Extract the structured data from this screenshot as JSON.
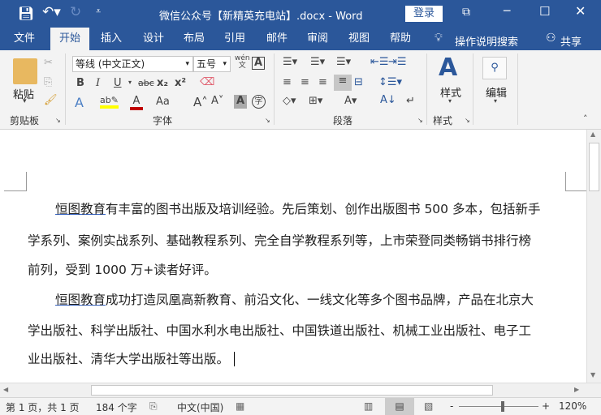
{
  "titlebar": {
    "doc_title": "微信公众号【新精英充电站】.docx - Word",
    "login": "登录",
    "save_icon": "save-icon",
    "undo_icon": "undo-icon",
    "redo_icon": "redo-icon"
  },
  "tabs": [
    "文件",
    "开始",
    "插入",
    "设计",
    "布局",
    "引用",
    "邮件",
    "审阅",
    "视图",
    "帮助"
  ],
  "tell_me": "操作说明搜索",
  "share": "共享",
  "ribbon": {
    "clipboard": {
      "paste": "粘贴",
      "label": "剪贴板"
    },
    "font": {
      "name": "等线 (中文正文)",
      "size": "五号",
      "label": "字体",
      "bold": "B",
      "italic": "I",
      "underline": "U",
      "strike": "abc",
      "sub": "x₂",
      "sup": "x²",
      "case": "Aa",
      "phonetic": "wén",
      "enclose": "字"
    },
    "paragraph": {
      "label": "段落"
    },
    "styles": {
      "button": "样式",
      "label": "样式"
    },
    "editing": {
      "button": "编辑"
    }
  },
  "document": {
    "lines": [
      {
        "link": "恒图教育",
        "text": "有丰富的图书出版及培训经验。先后策划、创作出版图书 500 多本，包括新手"
      },
      {
        "text": "学系列、案例实战系列、基础教程系列、完全自学教程系列等，上市荣登同类畅销书排行榜"
      },
      {
        "text": "前列，受到 1000 万+读者好评。"
      },
      {
        "link": "恒图教育",
        "text": "成功打造凤凰高新教育、前沿文化、一线文化等多个图书品牌，产品在北京大"
      },
      {
        "text": "学出版社、科学出版社、中国水利水电出版社、中国铁道出版社、机械工业出版社、电子工"
      },
      {
        "text": "业出版社、清华大学出版社等出版。"
      }
    ]
  },
  "status": {
    "page": "第 1 页，共 1 页",
    "words": "184 个字",
    "language": "中文(中国)",
    "zoom": "120%",
    "zoom_percent": 120
  }
}
